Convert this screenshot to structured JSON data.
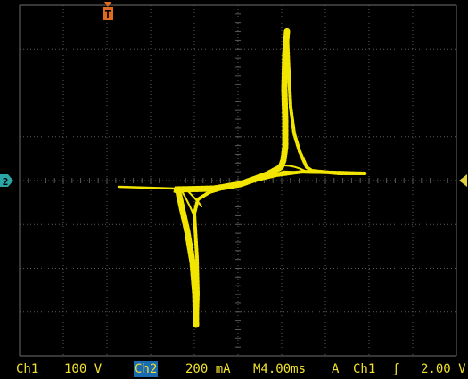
{
  "markers": {
    "trigger_position": "T",
    "ch2_level": "2"
  },
  "status_bar": {
    "ch1_label": "Ch1",
    "ch1_scale": "100 V",
    "ch2_label": "Ch2",
    "ch2_scale": "200 mA",
    "timebase": "M4.00ms",
    "trigger_mode": "A",
    "trigger_source": "Ch1",
    "trigger_slope": "ʃ",
    "trigger_level": "2.00 V"
  },
  "colors": {
    "trace": "#f2e600",
    "grid": "#5a5a5a",
    "marker": "#e06a20",
    "ch2_marker": "#2aa6a6",
    "status_text": "#f0e030",
    "status_box": "#1b6bb0"
  }
}
